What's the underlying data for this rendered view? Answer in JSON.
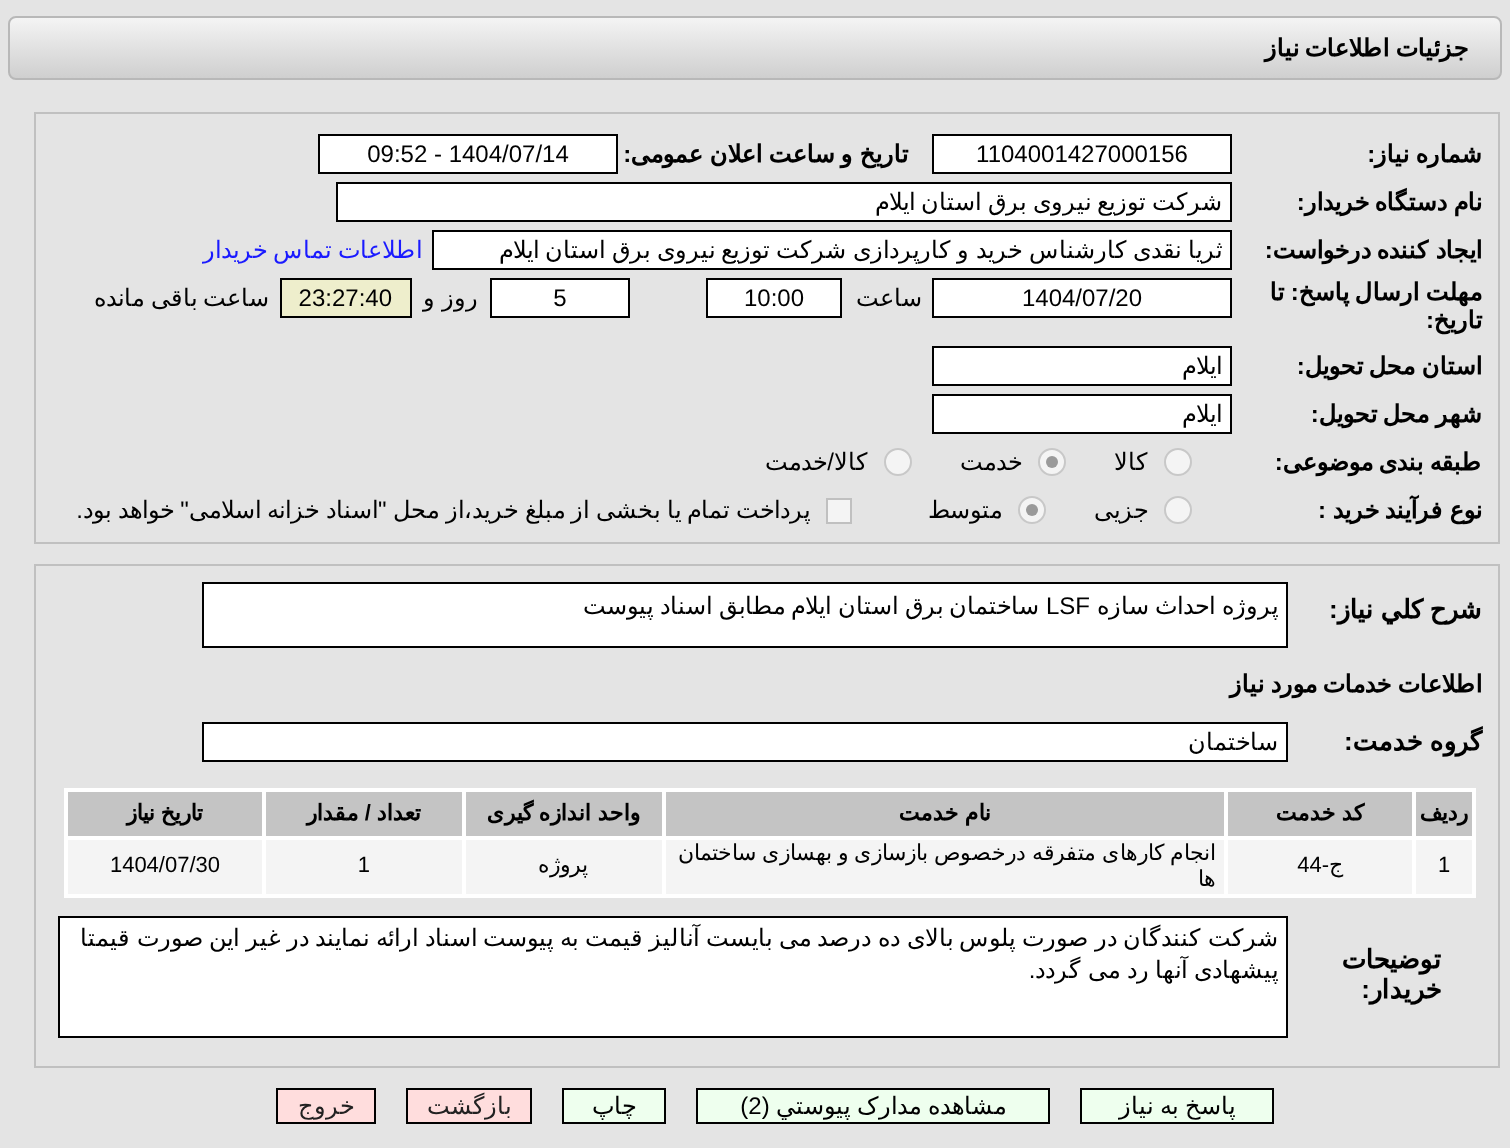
{
  "header": {
    "title": "جزئیات اطلاعات نیاز"
  },
  "details": {
    "need_number": {
      "label": "شماره نیاز:",
      "value": "1104001427000156"
    },
    "announce_date": {
      "label": "تاریخ و ساعت اعلان عمومی:",
      "value": "1404/07/14 - 09:52"
    },
    "buyer": {
      "label": "نام دستگاه خریدار:",
      "value": "شرکت توزیع نیروی برق استان ایلام"
    },
    "requester": {
      "label": "ایجاد کننده درخواست:",
      "value": "ثریا نقدی کارشناس خرید و کارپردازی شرکت توزیع نیروی برق استان ایلام",
      "link": "اطلاعات تماس خریدار"
    },
    "deadline": {
      "label": "مهلت ارسال پاسخ: تا تاریخ:",
      "date": "1404/07/20",
      "time_label": "ساعت",
      "time": "10:00",
      "days": "5",
      "days_label": "روز و",
      "remaining": "23:27:40",
      "remaining_label": "ساعت باقی مانده"
    },
    "province": {
      "label": "استان محل تحویل:",
      "value": "ایلام"
    },
    "city": {
      "label": "شهر محل تحویل:",
      "value": "ایلام"
    },
    "category": {
      "label": "طبقه بندی موضوعی:",
      "options": [
        {
          "label": "کالا",
          "selected": false
        },
        {
          "label": "خدمت",
          "selected": true
        },
        {
          "label": "کالا/خدمت",
          "selected": false
        }
      ]
    },
    "purchase_type": {
      "label": "نوع فرآیند خرید :",
      "options": [
        {
          "label": "جزیی",
          "selected": false
        },
        {
          "label": "متوسط",
          "selected": true
        }
      ],
      "payment": {
        "label": "پرداخت تمام یا بخشی از مبلغ خرید،از محل \"اسناد خزانه اسلامی\" خواهد بود.",
        "checked": false
      }
    }
  },
  "summary": {
    "label": "شرح کلي نياز:",
    "value": "پروژه احداث سازه LSF ساختمان برق استان ایلام مطابق اسناد پیوست"
  },
  "services_heading": "اطلاعات خدمات مورد نياز",
  "service_group": {
    "label": "گروه خدمت:",
    "value": "ساختمان"
  },
  "table": {
    "columns": [
      "رديف",
      "کد خدمت",
      "نام خدمت",
      "واحد اندازه گيری",
      "تعداد / مقدار",
      "تاريخ نياز"
    ],
    "rows": [
      [
        "1",
        "ج-44",
        "انجام کارهای متفرقه درخصوص بازسازی و بهسازی ساختمان ها",
        "پروژه",
        "1",
        "1404/07/30"
      ]
    ]
  },
  "buyer_notes": {
    "label": "توضیحات خریدار:",
    "value": "شرکت کنندگان در صورت پلوس بالای ده درصد می بایست آنالیز قیمت به پیوست اسناد ارائه نمایند در غیر این صورت قیمتا پیشهادی آنها رد می گردد."
  },
  "buttons": [
    {
      "label": "پاسخ به نیاز",
      "kind": "primary"
    },
    {
      "label": "مشاهده مدارک پیوستي (2)",
      "kind": "primary"
    },
    {
      "label": "چاپ",
      "kind": "primary"
    },
    {
      "label": "بازگشت",
      "kind": "danger"
    },
    {
      "label": "خروج",
      "kind": "danger"
    }
  ]
}
